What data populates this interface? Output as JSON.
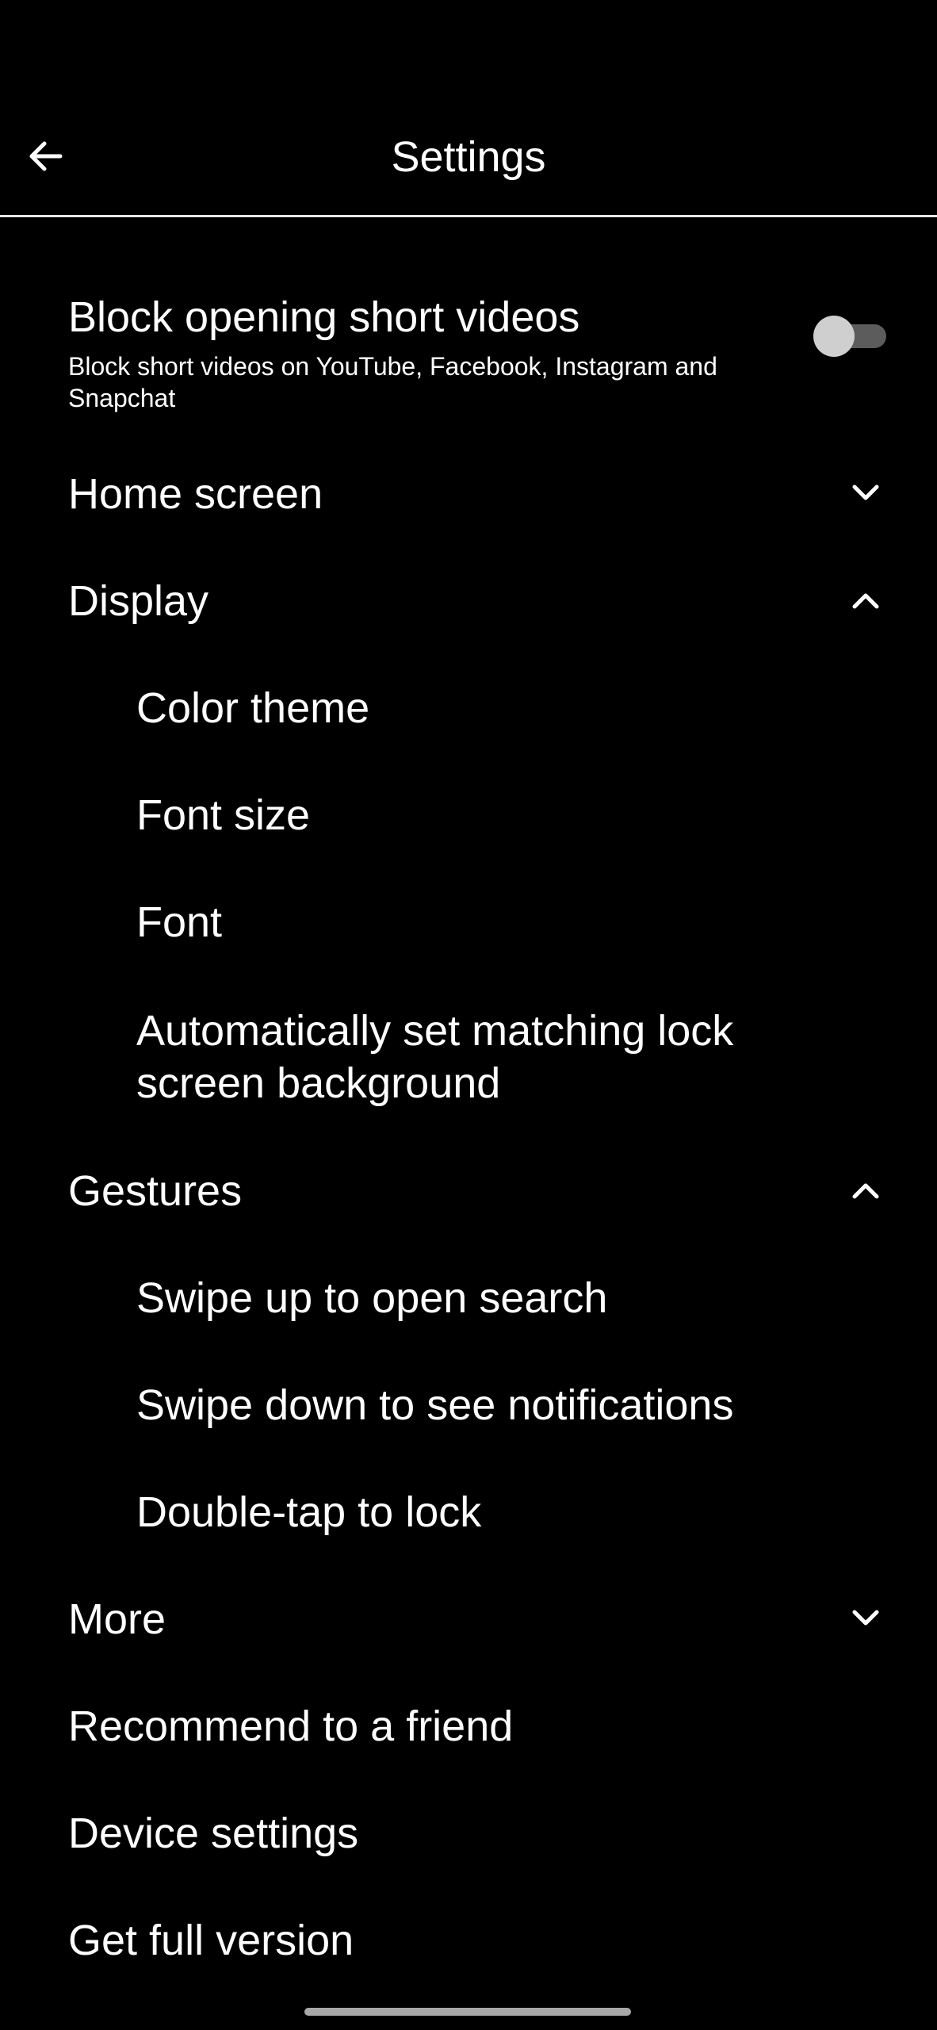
{
  "header": {
    "title": "Settings",
    "back_icon": "arrow-left-icon"
  },
  "block_short_videos": {
    "title": "Block opening short videos",
    "subtitle": "Block short videos on YouTube, Facebook, Instagram and Snapchat",
    "toggle_on": false
  },
  "sections": {
    "home_screen": {
      "label": "Home screen",
      "expanded": false
    },
    "display": {
      "label": "Display",
      "expanded": true,
      "items": [
        "Color theme",
        "Font size",
        "Font",
        "Automatically set matching lock screen background"
      ]
    },
    "gestures": {
      "label": "Gestures",
      "expanded": true,
      "items": [
        "Swipe up to open search",
        "Swipe down to see notifications",
        "Double-tap to lock"
      ]
    },
    "more": {
      "label": "More",
      "expanded": false
    }
  },
  "links": {
    "recommend": "Recommend to a friend",
    "device_settings": "Device settings",
    "full_version": "Get full version"
  },
  "colors": {
    "background": "#000000",
    "text": "#ffffff",
    "divider": "#e6e6e6",
    "toggle_track": "#5c5c5c",
    "toggle_thumb": "#cfcfcf"
  }
}
